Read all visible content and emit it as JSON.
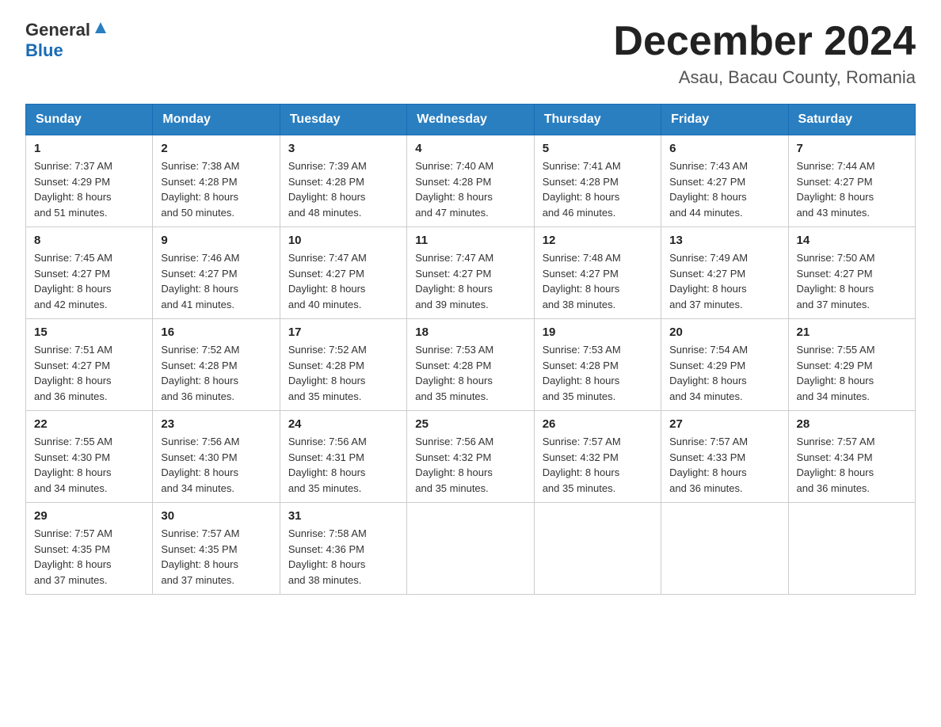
{
  "header": {
    "logo_general": "General",
    "logo_blue": "Blue",
    "month_title": "December 2024",
    "location": "Asau, Bacau County, Romania"
  },
  "days_of_week": [
    "Sunday",
    "Monday",
    "Tuesday",
    "Wednesday",
    "Thursday",
    "Friday",
    "Saturday"
  ],
  "weeks": [
    [
      {
        "day": "1",
        "sunrise": "7:37 AM",
        "sunset": "4:29 PM",
        "daylight": "8 hours and 51 minutes."
      },
      {
        "day": "2",
        "sunrise": "7:38 AM",
        "sunset": "4:28 PM",
        "daylight": "8 hours and 50 minutes."
      },
      {
        "day": "3",
        "sunrise": "7:39 AM",
        "sunset": "4:28 PM",
        "daylight": "8 hours and 48 minutes."
      },
      {
        "day": "4",
        "sunrise": "7:40 AM",
        "sunset": "4:28 PM",
        "daylight": "8 hours and 47 minutes."
      },
      {
        "day": "5",
        "sunrise": "7:41 AM",
        "sunset": "4:28 PM",
        "daylight": "8 hours and 46 minutes."
      },
      {
        "day": "6",
        "sunrise": "7:43 AM",
        "sunset": "4:27 PM",
        "daylight": "8 hours and 44 minutes."
      },
      {
        "day": "7",
        "sunrise": "7:44 AM",
        "sunset": "4:27 PM",
        "daylight": "8 hours and 43 minutes."
      }
    ],
    [
      {
        "day": "8",
        "sunrise": "7:45 AM",
        "sunset": "4:27 PM",
        "daylight": "8 hours and 42 minutes."
      },
      {
        "day": "9",
        "sunrise": "7:46 AM",
        "sunset": "4:27 PM",
        "daylight": "8 hours and 41 minutes."
      },
      {
        "day": "10",
        "sunrise": "7:47 AM",
        "sunset": "4:27 PM",
        "daylight": "8 hours and 40 minutes."
      },
      {
        "day": "11",
        "sunrise": "7:47 AM",
        "sunset": "4:27 PM",
        "daylight": "8 hours and 39 minutes."
      },
      {
        "day": "12",
        "sunrise": "7:48 AM",
        "sunset": "4:27 PM",
        "daylight": "8 hours and 38 minutes."
      },
      {
        "day": "13",
        "sunrise": "7:49 AM",
        "sunset": "4:27 PM",
        "daylight": "8 hours and 37 minutes."
      },
      {
        "day": "14",
        "sunrise": "7:50 AM",
        "sunset": "4:27 PM",
        "daylight": "8 hours and 37 minutes."
      }
    ],
    [
      {
        "day": "15",
        "sunrise": "7:51 AM",
        "sunset": "4:27 PM",
        "daylight": "8 hours and 36 minutes."
      },
      {
        "day": "16",
        "sunrise": "7:52 AM",
        "sunset": "4:28 PM",
        "daylight": "8 hours and 36 minutes."
      },
      {
        "day": "17",
        "sunrise": "7:52 AM",
        "sunset": "4:28 PM",
        "daylight": "8 hours and 35 minutes."
      },
      {
        "day": "18",
        "sunrise": "7:53 AM",
        "sunset": "4:28 PM",
        "daylight": "8 hours and 35 minutes."
      },
      {
        "day": "19",
        "sunrise": "7:53 AM",
        "sunset": "4:28 PM",
        "daylight": "8 hours and 35 minutes."
      },
      {
        "day": "20",
        "sunrise": "7:54 AM",
        "sunset": "4:29 PM",
        "daylight": "8 hours and 34 minutes."
      },
      {
        "day": "21",
        "sunrise": "7:55 AM",
        "sunset": "4:29 PM",
        "daylight": "8 hours and 34 minutes."
      }
    ],
    [
      {
        "day": "22",
        "sunrise": "7:55 AM",
        "sunset": "4:30 PM",
        "daylight": "8 hours and 34 minutes."
      },
      {
        "day": "23",
        "sunrise": "7:56 AM",
        "sunset": "4:30 PM",
        "daylight": "8 hours and 34 minutes."
      },
      {
        "day": "24",
        "sunrise": "7:56 AM",
        "sunset": "4:31 PM",
        "daylight": "8 hours and 35 minutes."
      },
      {
        "day": "25",
        "sunrise": "7:56 AM",
        "sunset": "4:32 PM",
        "daylight": "8 hours and 35 minutes."
      },
      {
        "day": "26",
        "sunrise": "7:57 AM",
        "sunset": "4:32 PM",
        "daylight": "8 hours and 35 minutes."
      },
      {
        "day": "27",
        "sunrise": "7:57 AM",
        "sunset": "4:33 PM",
        "daylight": "8 hours and 36 minutes."
      },
      {
        "day": "28",
        "sunrise": "7:57 AM",
        "sunset": "4:34 PM",
        "daylight": "8 hours and 36 minutes."
      }
    ],
    [
      {
        "day": "29",
        "sunrise": "7:57 AM",
        "sunset": "4:35 PM",
        "daylight": "8 hours and 37 minutes."
      },
      {
        "day": "30",
        "sunrise": "7:57 AM",
        "sunset": "4:35 PM",
        "daylight": "8 hours and 37 minutes."
      },
      {
        "day": "31",
        "sunrise": "7:58 AM",
        "sunset": "4:36 PM",
        "daylight": "8 hours and 38 minutes."
      },
      null,
      null,
      null,
      null
    ]
  ],
  "labels": {
    "sunrise": "Sunrise:",
    "sunset": "Sunset:",
    "daylight": "Daylight:"
  }
}
